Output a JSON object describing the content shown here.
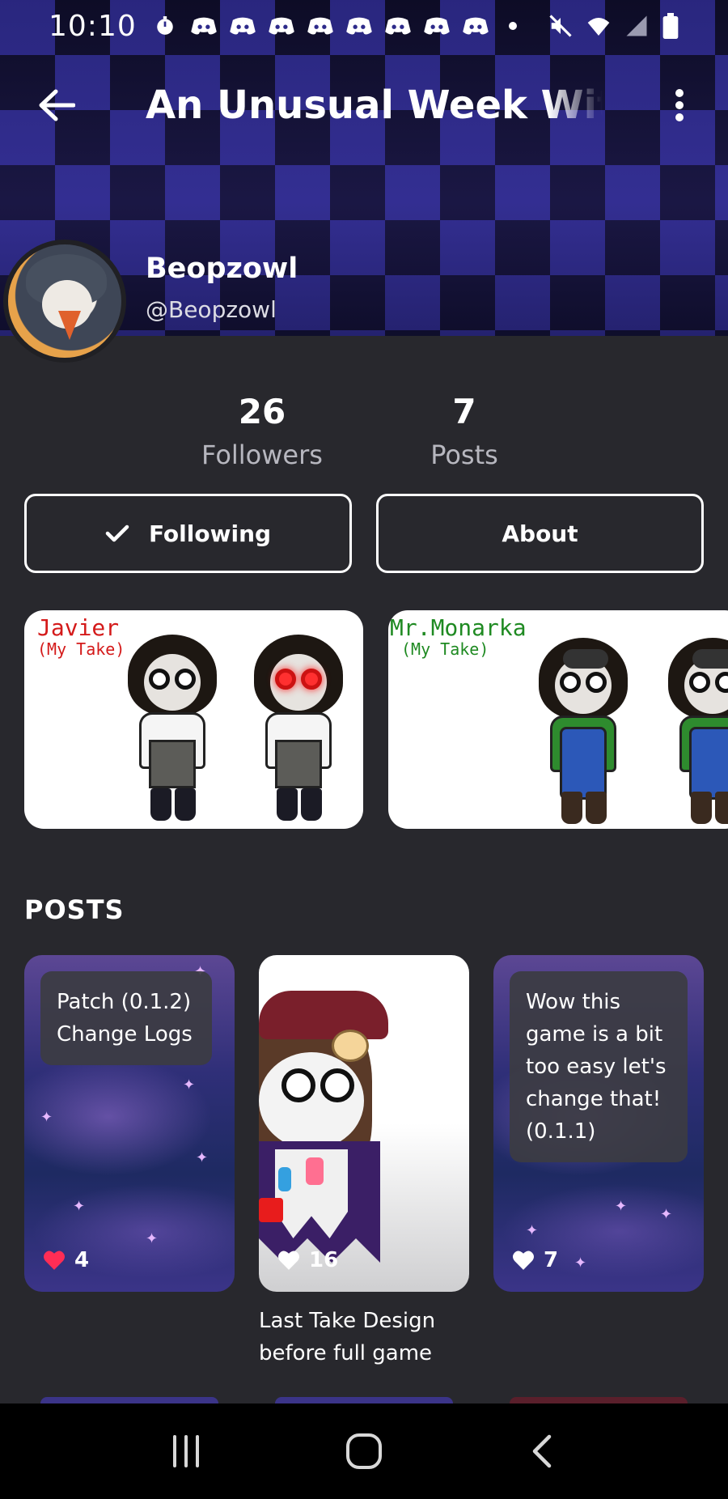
{
  "status_bar": {
    "time": "10:10",
    "left_icons": [
      "timer-icon",
      "discord-icon",
      "discord-icon",
      "discord-icon",
      "discord-icon",
      "discord-icon",
      "discord-icon",
      "discord-icon",
      "discord-icon"
    ],
    "right_icons": [
      "mute-icon",
      "wifi-icon",
      "signal-icon",
      "battery-icon"
    ]
  },
  "app_bar": {
    "title": "An Unusual Week With J",
    "back_icon": "arrow-left-icon",
    "menu_icon": "more-vertical-icon"
  },
  "profile": {
    "name": "Beopzowl",
    "handle": "@Beopzowl"
  },
  "stats": {
    "followers_count": "26",
    "followers_label": "Followers",
    "posts_count": "7",
    "posts_label": "Posts"
  },
  "actions": {
    "following_label": "Following",
    "about_label": "About"
  },
  "featured": [
    {
      "title": "Javier",
      "subtitle": "(My Take)",
      "title_color": "#d41a1a"
    },
    {
      "title": "Mr.Monarka",
      "subtitle": "(My Take)",
      "title_color": "#1f8a22"
    }
  ],
  "posts_section": {
    "heading": "POSTS",
    "items": [
      {
        "overlay_text": "Patch (0.1.2) Change Logs",
        "likes": "4",
        "liked": true,
        "caption": ""
      },
      {
        "overlay_text": "",
        "likes": "16",
        "liked": false,
        "caption": "Last Take Design before full game"
      },
      {
        "overlay_text": "Wow this game is a bit too easy let's change that! (0.1.1)",
        "likes": "7",
        "liked": false,
        "caption": ""
      }
    ]
  },
  "nav_bar": {
    "items": [
      "recent-apps-icon",
      "home-icon",
      "back-icon"
    ]
  },
  "colors": {
    "background": "#28282d",
    "heart_liked": "#ff2d55",
    "heart_default": "#ffffff"
  }
}
